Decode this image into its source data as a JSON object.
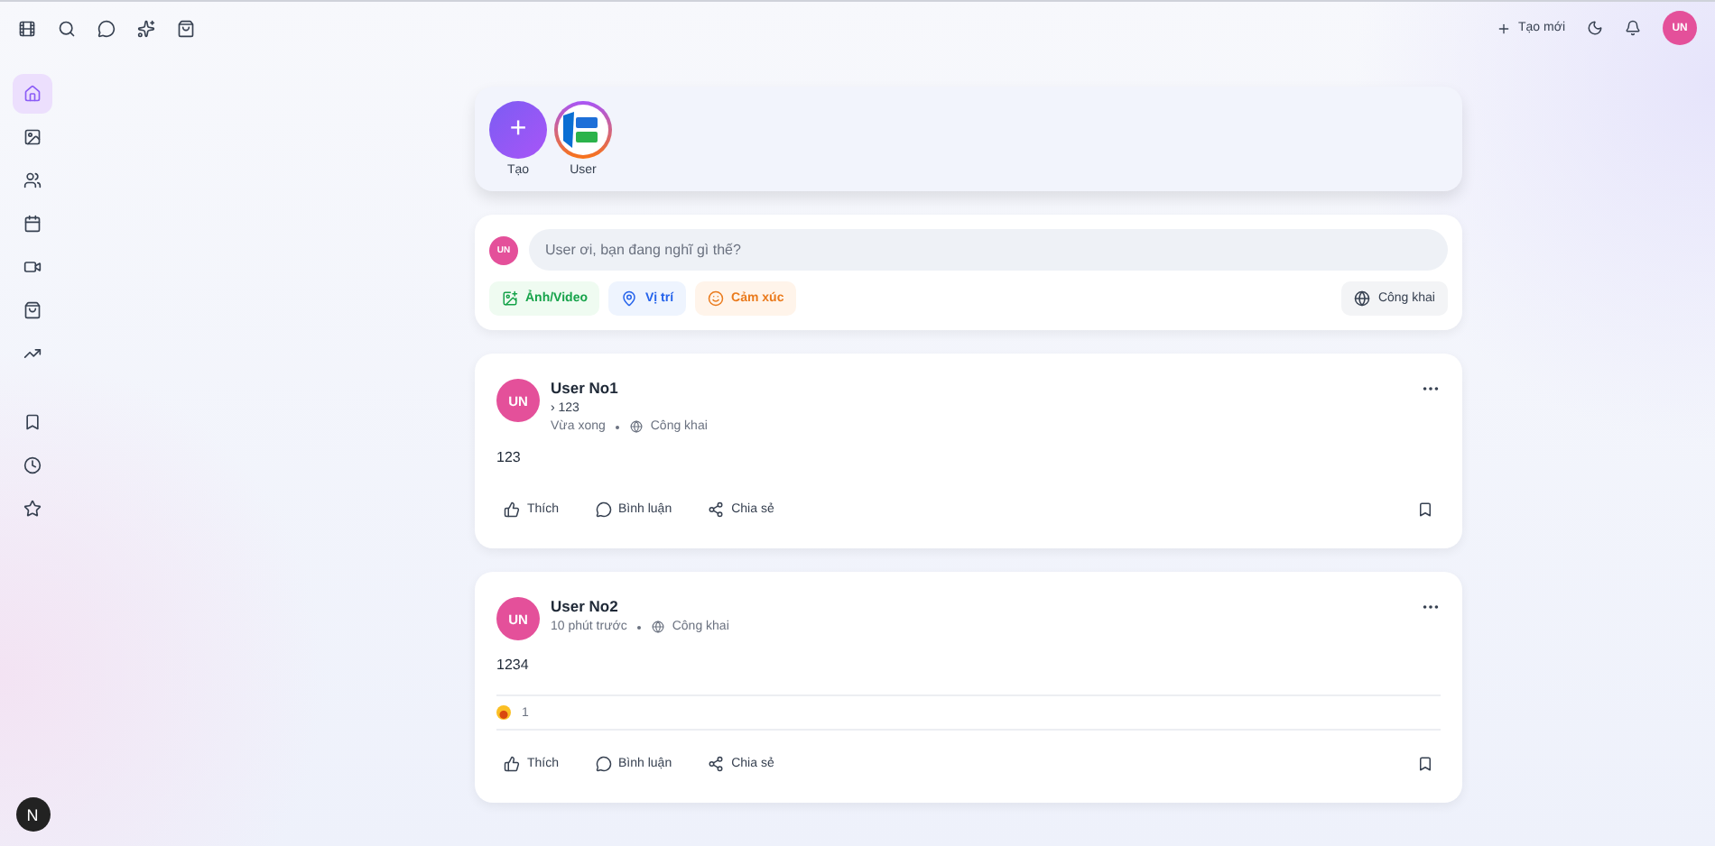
{
  "topbar": {
    "create_label": "Tạo mới",
    "avatar": "UN"
  },
  "sidebar": {
    "items": [
      {
        "selected": true
      },
      {
        "selected": false
      },
      {
        "selected": false
      },
      {
        "selected": false
      },
      {
        "selected": false
      },
      {
        "selected": false
      },
      {
        "selected": false
      },
      {
        "selected": false
      },
      {
        "selected": false
      },
      {
        "selected": false
      }
    ],
    "badge": "N"
  },
  "stories": [
    {
      "kind": "create",
      "label": "Tạo",
      "symbol": "+"
    },
    {
      "kind": "user",
      "label": "User"
    }
  ],
  "composer": {
    "avatar": "UN",
    "placeholder": "User ơi, bạn đang nghĩ gì thế?",
    "actions": [
      {
        "kind": "media",
        "label": "Ảnh/Video"
      },
      {
        "kind": "location",
        "label": "Vị trí"
      },
      {
        "kind": "feeling",
        "label": "Cảm xúc"
      }
    ],
    "privacy": "Công khai"
  },
  "posts": [
    {
      "avatar": "UN",
      "author": "User No1",
      "subtitle": "› 123",
      "time": "Vừa xong",
      "privacy": "Công khai",
      "content": "123",
      "actions": [
        "Thích",
        "Bình luận",
        "Chia sẻ"
      ]
    },
    {
      "avatar": "UN",
      "author": "User No2",
      "time": "10 phút trước",
      "privacy": "Công khai",
      "content": "1234",
      "reactions": {
        "count": "1"
      },
      "actions": [
        "Thích",
        "Bình luận",
        "Chia sẻ"
      ]
    }
  ]
}
